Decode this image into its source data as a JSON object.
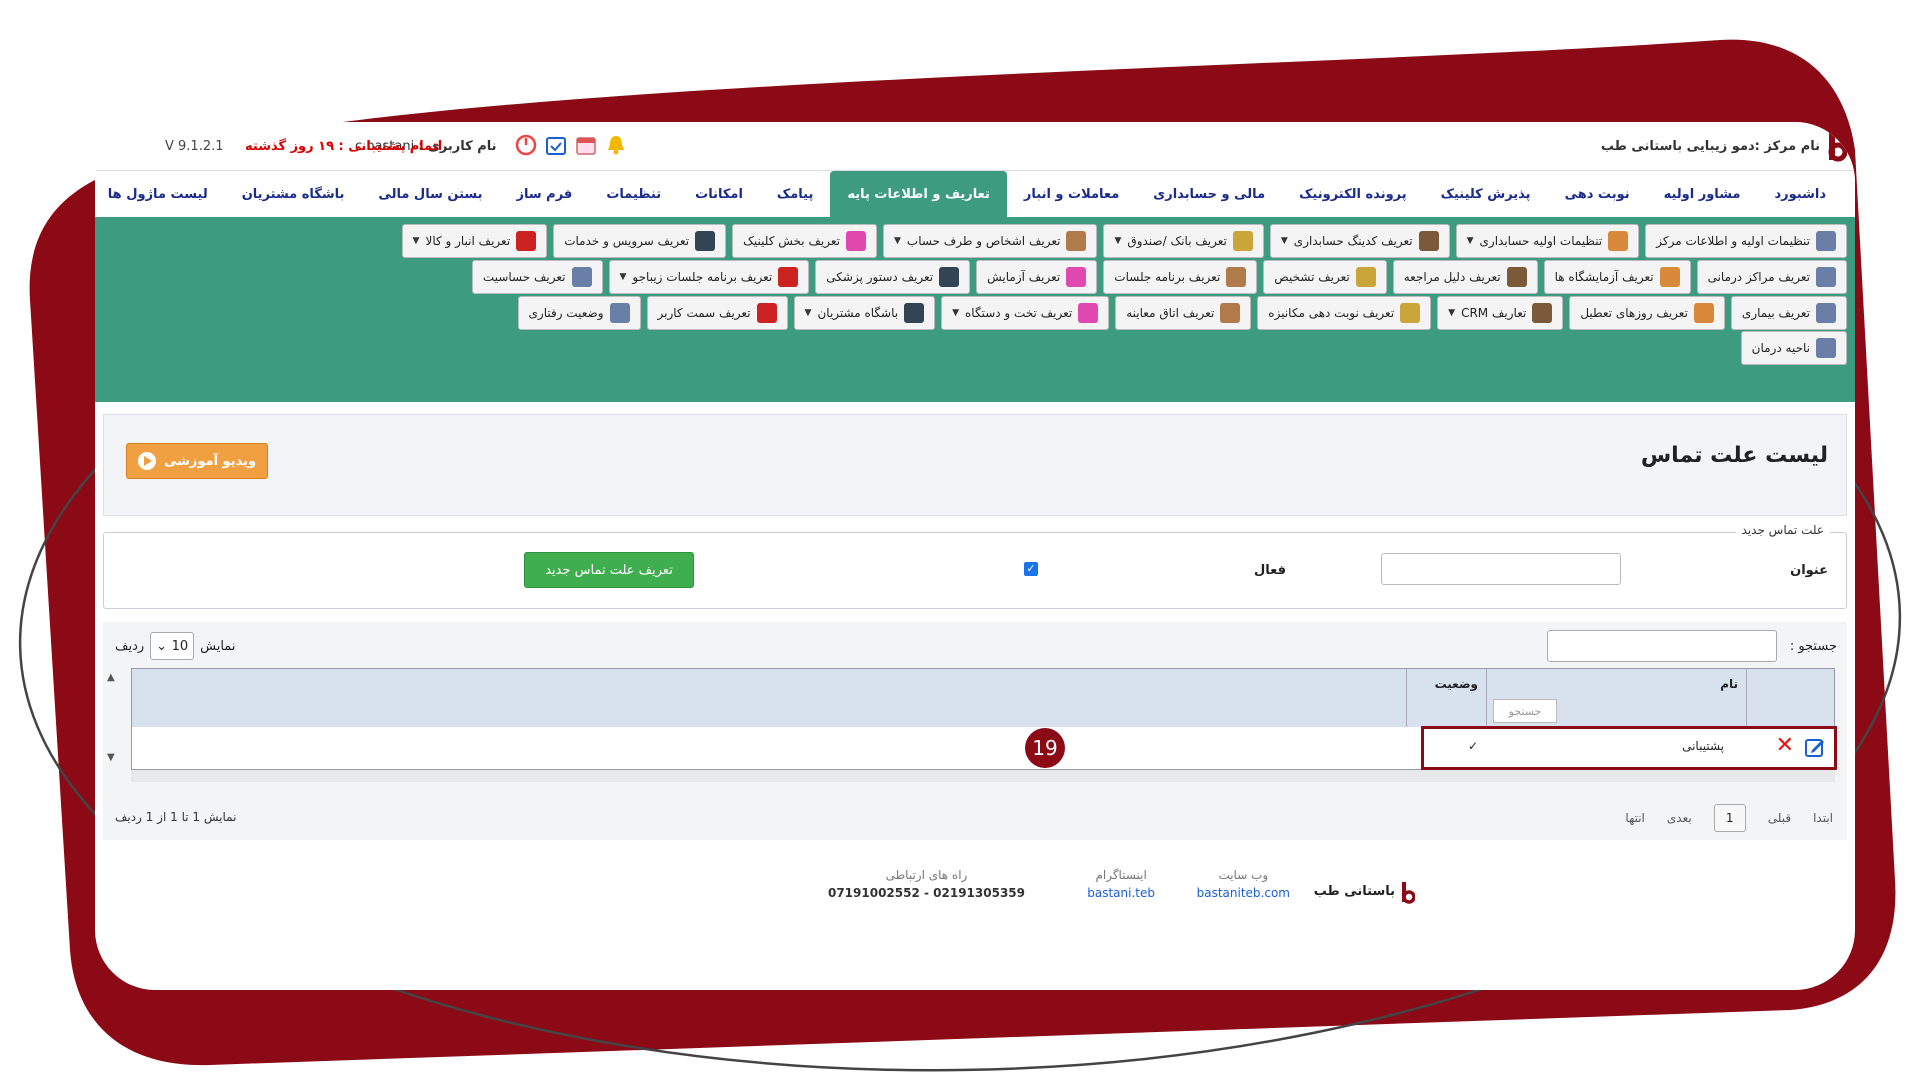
{
  "colors": {
    "brand_dark_red": "#8b0a16",
    "menu_green": "#3d9c7f",
    "menu_text": "#1a2b8c",
    "accent_orange": "#f0a040",
    "save_green": "#3fae4f"
  },
  "topbar": {
    "center_label": "نام مرکز :",
    "center_name": "دمو زیبایی باستانی طب",
    "version": "V 9.1.2.1",
    "support_notice": "اتمام پشتیبانی : ۱۹ روز گذشته",
    "username_label": "نام کاربری :",
    "username": "c.bastani",
    "icons": [
      "logout-icon",
      "calendar-check-icon",
      "calendar-icon",
      "bell-icon"
    ]
  },
  "menu": [
    {
      "label": "داشبورد"
    },
    {
      "label": "مشاور اولیه"
    },
    {
      "label": "نوبت دهی"
    },
    {
      "label": "پذیرش کلینیک"
    },
    {
      "label": "پرونده الکترونیک"
    },
    {
      "label": "مالی و حسابداری"
    },
    {
      "label": "معاملات و انبار"
    },
    {
      "label": "تعاریف و اطلاعات پایه"
    },
    {
      "label": "پیامک"
    },
    {
      "label": "امکانات"
    },
    {
      "label": "تنظیمات"
    },
    {
      "label": "فرم ساز"
    },
    {
      "label": "بستن سال مالی"
    },
    {
      "label": "باشگاه مشتریان"
    },
    {
      "label": "لیست ماژول ها"
    }
  ],
  "submenu": {
    "row1": [
      {
        "label": "تنظیمات اولیه و اطلاعات مرکز",
        "caret": false
      },
      {
        "label": "تنظیمات اولیه حسابداری",
        "caret": true
      },
      {
        "label": "تعریف کدینگ حسابداری",
        "caret": true
      },
      {
        "label": "تعریف بانک /صندوق",
        "caret": true
      },
      {
        "label": "تعریف اشخاص و طرف حساب",
        "caret": true
      },
      {
        "label": "تعریف بخش کلینیک",
        "caret": false
      },
      {
        "label": "تعریف سرویس و خدمات",
        "caret": false
      },
      {
        "label": "تعریف انبار و کالا",
        "caret": true
      }
    ],
    "row2": [
      {
        "label": "تعریف مراکز درمانی",
        "caret": false
      },
      {
        "label": "تعریف آزمایشگاه ها",
        "caret": false
      },
      {
        "label": "تعریف دلیل مراجعه",
        "caret": false
      },
      {
        "label": "تعریف تشخیص",
        "caret": false
      },
      {
        "label": "تعریف برنامه جلسات",
        "caret": false
      },
      {
        "label": "تعریف آزمایش",
        "caret": false
      },
      {
        "label": "تعریف دستور پزشکی",
        "caret": false
      },
      {
        "label": "تعریف برنامه جلسات زیباجو",
        "caret": true
      },
      {
        "label": "تعریف حساسیت",
        "caret": false
      }
    ],
    "row3": [
      {
        "label": "تعریف بیماری",
        "caret": false
      },
      {
        "label": "تعریف روزهای تعطیل",
        "caret": false
      },
      {
        "label": "تعاریف CRM",
        "caret": true
      },
      {
        "label": "تعریف نوبت دهی مکانیزه",
        "caret": false
      },
      {
        "label": "تعریف اتاق معاینه",
        "caret": false
      },
      {
        "label": "تعریف تخت و دستگاه",
        "caret": true
      },
      {
        "label": "باشگاه مشتریان",
        "caret": true
      },
      {
        "label": "تعریف سمت کاربر",
        "caret": false
      },
      {
        "label": "وضعیت رفتاری",
        "caret": false
      }
    ],
    "row4": [
      {
        "label": "ناحیه درمان",
        "caret": false
      }
    ]
  },
  "page": {
    "title": "لیست علت تماس",
    "video_button": "ویدیو آموزشی"
  },
  "form": {
    "legend": "علت تماس جدید",
    "title_label": "عنوان",
    "title_value": "",
    "active_label": "فعال",
    "active_checked": true,
    "submit_label": "تعریف علت تماس جدید"
  },
  "list": {
    "search_label": "جستجو :",
    "search_value": "",
    "show_prefix": "نمایش",
    "page_size": "10",
    "show_suffix": "ردیف",
    "columns": [
      "نام",
      "وضعیت"
    ],
    "column_search_placeholder": "جستجو",
    "rows": [
      {
        "name": "پشتیبانی",
        "status": "✓"
      }
    ],
    "callout_number": "19",
    "pager": {
      "first": "ابتدا",
      "prev": "قبلی",
      "current": "1",
      "next": "بعدی",
      "last": "انتها"
    },
    "info": "نمایش 1 تا 1 از 1 ردیف"
  },
  "footer": {
    "brand": "باستانی طب",
    "website_label": "وب سایت",
    "website": "bastaniteb.com",
    "instagram_label": "اینستاگرام",
    "instagram": "bastani.teb",
    "contact_label": "راه های ارتباطی",
    "contact": "07191002552 - 02191305359"
  }
}
